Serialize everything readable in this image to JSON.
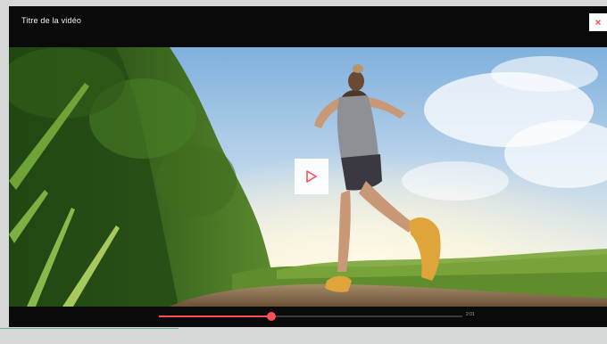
{
  "modal": {
    "title": "Titre de la vidéo",
    "close_icon": "close-icon",
    "close_glyph": "×",
    "accent_color": "#ff4d56"
  },
  "player": {
    "play_icon": "play-icon",
    "progress_fraction": 0.37,
    "time_label": "2:01"
  }
}
